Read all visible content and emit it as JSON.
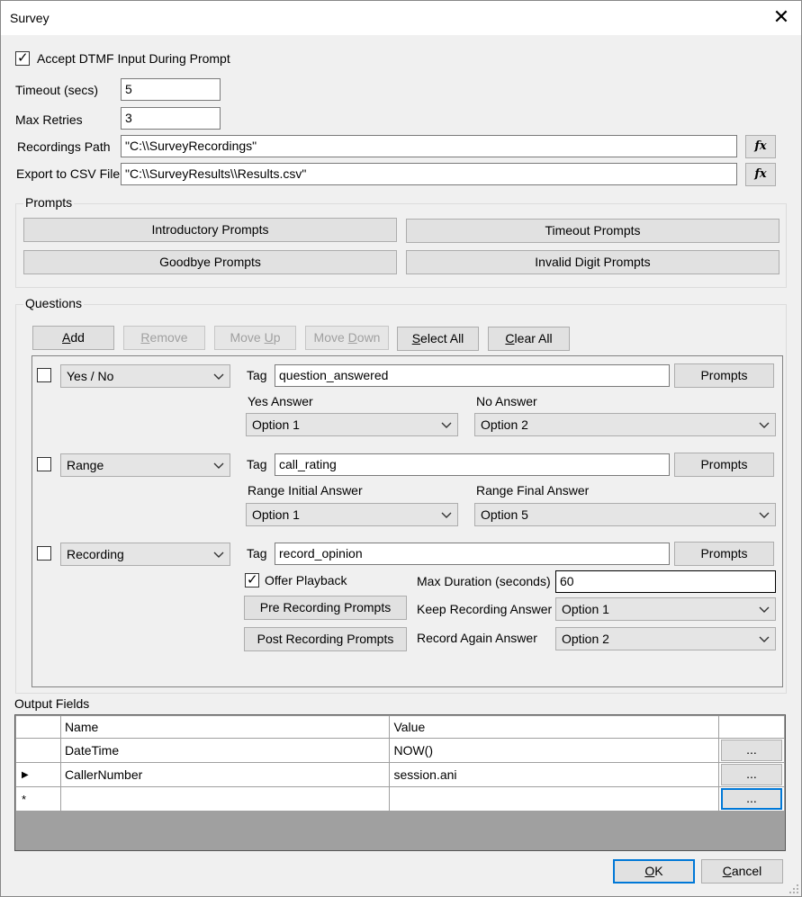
{
  "window": {
    "title": "Survey"
  },
  "options": {
    "accept_dtmf_label": "Accept DTMF Input During Prompt",
    "accept_dtmf_checked": true,
    "timeout_label": "Timeout (secs)",
    "timeout_value": "5",
    "max_retries_label": "Max Retries",
    "max_retries_value": "3",
    "recordings_path_label": "Recordings Path",
    "recordings_path_value": "\"C:\\\\SurveyRecordings\"",
    "export_csv_label": "Export to CSV File",
    "export_csv_value": "\"C:\\\\SurveyResults\\\\Results.csv\"",
    "fx_label": "fx"
  },
  "prompts": {
    "group_label": "Prompts",
    "introductory": "Introductory Prompts",
    "timeout": "Timeout Prompts",
    "goodbye": "Goodbye Prompts",
    "invalid_digit": "Invalid Digit Prompts"
  },
  "questions": {
    "group_label": "Questions",
    "toolbar": {
      "add_pre": "",
      "add_u": "A",
      "add_post": "dd",
      "remove_pre": "",
      "remove_u": "R",
      "remove_post": "emove",
      "moveup_pre": "Move ",
      "moveup_u": "U",
      "moveup_post": "p",
      "movedown_pre": "Move ",
      "movedown_u": "D",
      "movedown_post": "own",
      "selectall_pre": "",
      "selectall_u": "S",
      "selectall_post": "elect All",
      "clearall_pre": "",
      "clearall_u": "C",
      "clearall_post": "lear All"
    },
    "tag_label": "Tag",
    "prompts_button": "Prompts",
    "items": [
      {
        "type": "Yes / No",
        "tag": "question_answered",
        "left_label": "Yes Answer",
        "left_value": "Option 1",
        "right_label": "No Answer",
        "right_value": "Option 2"
      },
      {
        "type": "Range",
        "tag": "call_rating",
        "left_label": "Range Initial Answer",
        "left_value": "Option 1",
        "right_label": "Range Final Answer",
        "right_value": "Option 5"
      },
      {
        "type": "Recording",
        "tag": "record_opinion",
        "offer_playback_label": "Offer Playback",
        "offer_playback_checked": true,
        "pre_recording_button": "Pre Recording Prompts",
        "post_recording_button": "Post Recording Prompts",
        "max_duration_label": "Max Duration (seconds)",
        "max_duration_value": "60",
        "keep_recording_label": "Keep Recording Answer",
        "keep_recording_value": "Option 1",
        "record_again_label": "Record Again Answer",
        "record_again_value": "Option 2"
      }
    ]
  },
  "output_fields": {
    "group_label": "Output Fields",
    "columns": [
      "Name",
      "Value"
    ],
    "rows": [
      {
        "name": "DateTime",
        "value": "NOW()"
      },
      {
        "name": "CallerNumber",
        "value": "session.ani"
      }
    ],
    "ellipsis": "...",
    "new_row_marker": "*",
    "current_row_marker": "▶"
  },
  "footer": {
    "ok_u": "O",
    "ok_post": "K",
    "cancel_u": "C",
    "cancel_post": "ancel"
  }
}
